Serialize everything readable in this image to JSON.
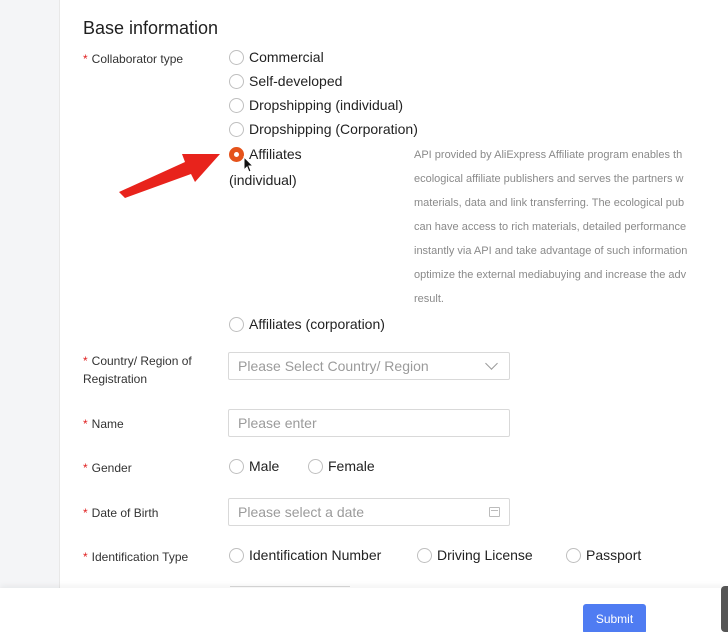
{
  "section_title": "Base information",
  "required_mark": "*",
  "collaborator": {
    "label": "Collaborator type",
    "options": [
      {
        "label": "Commercial"
      },
      {
        "label": "Self-developed"
      },
      {
        "label": "Dropshipping (individual)"
      },
      {
        "label": "Dropshipping (Corporation)"
      },
      {
        "label": "Affiliates"
      },
      {
        "label": "Affiliates (corporation)"
      }
    ],
    "selected_index": 4,
    "selected_sub_label": "(individual)",
    "description_lines": [
      "API provided by AliExpress Affiliate program enables th",
      "ecological affiliate publishers and serves the partners w",
      "materials, data and link transferring. The ecological pub",
      "can have access to rich materials, detailed performance",
      "instantly via API and take advantage of such information",
      "optimize the external mediabuying and increase the adv",
      "result."
    ]
  },
  "country": {
    "label_line1": "Country/ Region of",
    "label_line2": "Registration",
    "placeholder": "Please Select Country/ Region"
  },
  "name": {
    "label": "Name",
    "placeholder": "Please enter"
  },
  "gender": {
    "label": "Gender",
    "options": [
      "Male",
      "Female"
    ]
  },
  "dob": {
    "label": "Date of Birth",
    "placeholder": "Please select a date"
  },
  "id_type": {
    "label": "Identification Type",
    "options": [
      "Identification Number",
      "Driving License",
      "Passport"
    ]
  },
  "submit_label": "Submit",
  "colors": {
    "accent": "#e5531b",
    "primary_button": "#4f7cf2",
    "required": "#e02020",
    "annotation_arrow": "#e8231c"
  }
}
